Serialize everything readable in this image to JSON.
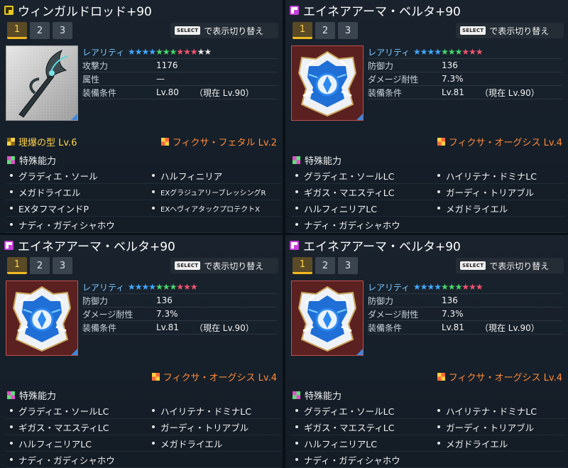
{
  "panels": [
    {
      "category": "weapon",
      "title": "ウィンガルドロッド+90",
      "tabs": [
        "1",
        "2",
        "3"
      ],
      "select_key": "SELECT",
      "select_text": "で表示切り替え",
      "rarity_label": "レアリティ",
      "rarity_stars": [
        "blue",
        "blue",
        "blue",
        "blue",
        "green",
        "green",
        "green",
        "red",
        "red",
        "red",
        "white",
        "white"
      ],
      "stats": [
        {
          "label": "攻撃力",
          "value": "1176",
          "now": ""
        },
        {
          "label": "属性",
          "value": "—",
          "now": ""
        },
        {
          "label": "装備条件",
          "value": "Lv.80",
          "now": "（現在  Lv.90）"
        }
      ],
      "affix_left": "理爆の型  Lv.6",
      "affix_right": "フィクサ・フェタル  Lv.2",
      "special_label": "特殊能力",
      "abilities": [
        "グラディエ・ソール",
        "ハルフィニリア",
        "メガドライエル",
        "EXグラジュアリーブレッシングR",
        "EXタフマインドP",
        "EXヘヴィアタックプロテクトX",
        "ナディ・ガディシャホウ",
        ""
      ]
    },
    {
      "category": "armor",
      "title": "エイネアアーマ・ベルタ+90",
      "tabs": [
        "1",
        "2",
        "3"
      ],
      "select_key": "SELECT",
      "select_text": "で表示切り替え",
      "rarity_label": "レアリティ",
      "rarity_stars": [
        "blue",
        "blue",
        "blue",
        "blue",
        "green",
        "green",
        "green",
        "red",
        "red",
        "red"
      ],
      "stats": [
        {
          "label": "防御力",
          "value": "136",
          "now": ""
        },
        {
          "label": "ダメージ耐性",
          "value": "7.3%",
          "now": ""
        },
        {
          "label": "装備条件",
          "value": "Lv.81",
          "now": "（現在  Lv.90）"
        }
      ],
      "affix_left": "",
      "affix_right": "フィクサ・オーグシス  Lv.4",
      "special_label": "特殊能力",
      "abilities": [
        "グラディエ・ソールLC",
        "ハイリテナ・ドミナLC",
        "ギガス・マエスティLC",
        "ガーディ・トリアブル",
        "ハルフィニリアLC",
        "メガドライエル",
        "ナディ・ガディシャホウ",
        ""
      ]
    },
    {
      "category": "armor",
      "title": "エイネアアーマ・ベルタ+90",
      "tabs": [
        "1",
        "2",
        "3"
      ],
      "select_key": "SELECT",
      "select_text": "で表示切り替え",
      "rarity_label": "レアリティ",
      "rarity_stars": [
        "blue",
        "blue",
        "blue",
        "blue",
        "green",
        "green",
        "green",
        "red",
        "red",
        "red"
      ],
      "stats": [
        {
          "label": "防御力",
          "value": "136",
          "now": ""
        },
        {
          "label": "ダメージ耐性",
          "value": "7.3%",
          "now": ""
        },
        {
          "label": "装備条件",
          "value": "Lv.81",
          "now": "（現在  Lv.90）"
        }
      ],
      "affix_left": "",
      "affix_right": "フィクサ・オーグシス  Lv.4",
      "special_label": "特殊能力",
      "abilities": [
        "グラディエ・ソールLC",
        "ハイリテナ・ドミナLC",
        "ギガス・マエスティLC",
        "ガーディ・トリアブル",
        "ハルフィニリアLC",
        "メガドライエル",
        "ナディ・ガディシャホウ",
        ""
      ]
    },
    {
      "category": "armor",
      "title": "エイネアアーマ・ベルタ+90",
      "tabs": [
        "1",
        "2",
        "3"
      ],
      "select_key": "SELECT",
      "select_text": "で表示切り替え",
      "rarity_label": "レアリティ",
      "rarity_stars": [
        "blue",
        "blue",
        "blue",
        "blue",
        "green",
        "green",
        "green",
        "red",
        "red",
        "red"
      ],
      "stats": [
        {
          "label": "防御力",
          "value": "136",
          "now": ""
        },
        {
          "label": "ダメージ耐性",
          "value": "7.3%",
          "now": ""
        },
        {
          "label": "装備条件",
          "value": "Lv.81",
          "now": "（現在  Lv.90）"
        }
      ],
      "affix_left": "",
      "affix_right": "フィクサ・オーグシス  Lv.4",
      "special_label": "特殊能力",
      "abilities": [
        "グラディエ・ソールLC",
        "ハイリテナ・ドミナLC",
        "ギガス・マエスティLC",
        "ガーディ・トリアブル",
        "ハルフィニリアLC",
        "メガドライエル",
        "ナディ・ガディシャホウ",
        ""
      ]
    }
  ],
  "colors": {
    "star_blue": "#41a8ff",
    "star_green": "#48d86b",
    "star_red": "#f05470",
    "star_white": "#e8e8e8",
    "affix_yellow": "#ffd24a",
    "affix_orange": "#ff8a3a"
  },
  "icons": {
    "weapon_category": "rod-category-icon",
    "armor_category": "armor-category-icon",
    "special": "special-ability-icon",
    "affix": "affix-icon"
  }
}
